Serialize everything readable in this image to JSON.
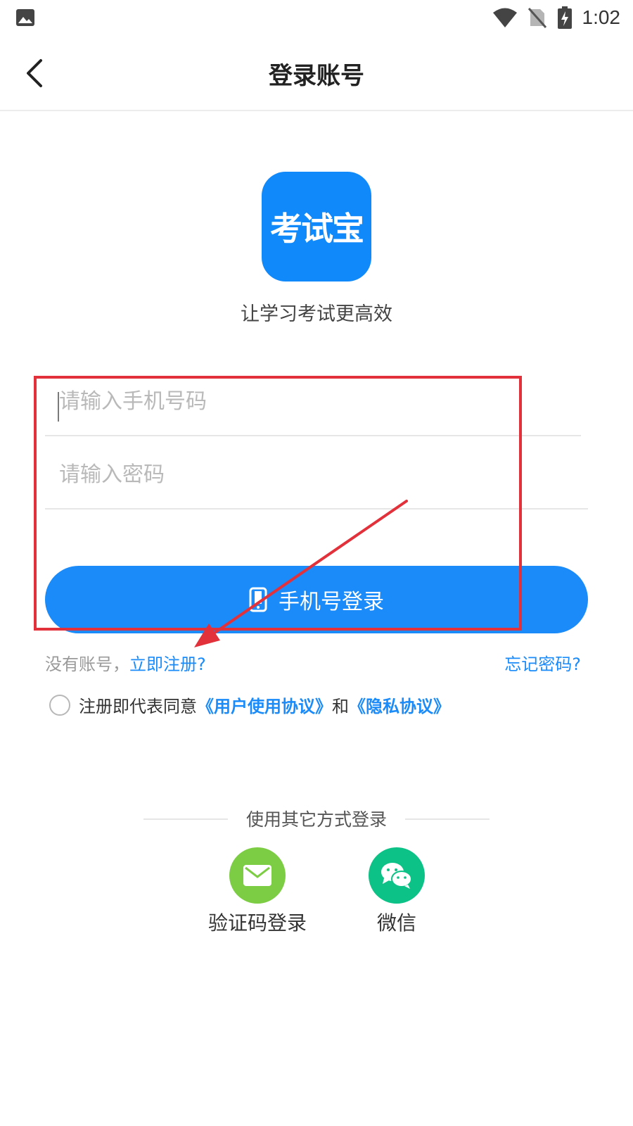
{
  "status_bar": {
    "time": "1:02",
    "icons": [
      "gallery-icon",
      "wifi-icon",
      "no-sim-icon",
      "battery-charging-icon"
    ]
  },
  "nav": {
    "title": "登录账号",
    "back_icon": "chevron-left-icon"
  },
  "logo": {
    "text": "考试宝",
    "color": "#1089fb"
  },
  "slogan": "让学习考试更高效",
  "form": {
    "phone_placeholder": "请输入手机号码",
    "password_placeholder": "请输入密码",
    "login_button_label": "手机号登录",
    "login_button_icon": "mobile-phone-icon"
  },
  "links": {
    "no_account_text": "没有账号，",
    "register_label": "立即注册?",
    "forgot_password_label": "忘记密码?"
  },
  "agreement": {
    "prefix": "注册即代表同意",
    "user_agreement": "《用户使用协议》",
    "and": "和",
    "privacy_policy": "《隐私协议》"
  },
  "other_login": {
    "divider_label": "使用其它方式登录",
    "methods": [
      {
        "label": "验证码登录",
        "icon": "envelope-icon",
        "color": "#7dcd44"
      },
      {
        "label": "微信",
        "icon": "wechat-icon",
        "color": "#0dc286"
      }
    ]
  },
  "colors": {
    "accent": "#1a8bf9",
    "annotation": "#e2313a"
  }
}
